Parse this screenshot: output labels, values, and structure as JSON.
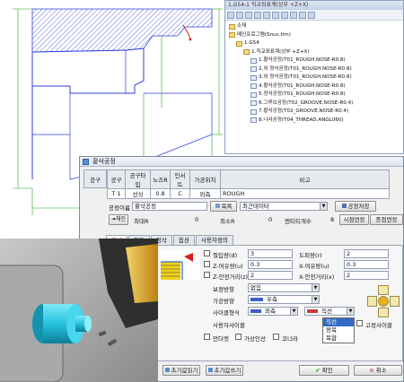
{
  "tree": {
    "title": "1.G54-1 직교좌표계(상부 +Z+X)",
    "items": [
      {
        "label": "소재",
        "level": 0,
        "kind": "folder"
      },
      {
        "label": "메인프로그램(Snuc.tlm)",
        "level": 0,
        "kind": "folder"
      },
      {
        "label": "1.G54",
        "level": 1,
        "kind": "folder"
      },
      {
        "label": "1.직교좌표계(상부 +Z+X)",
        "level": 2,
        "kind": "folder"
      },
      {
        "label": "1.황삭공정(T01_ROUGH.NOSE-R0.8)",
        "level": 3,
        "kind": "op"
      },
      {
        "label": "2.외 정삭공정(T01_ROUGH.NOSE-R0.8)",
        "level": 3,
        "kind": "op"
      },
      {
        "label": "3.외 정삭공정(T01_ROUGH.NOSE-R0.8)",
        "level": 3,
        "kind": "op"
      },
      {
        "label": "4.황삭공정(T01_ROUGH.NOSE-R0.8)",
        "level": 3,
        "kind": "op"
      },
      {
        "label": "5.정삭공정(T01_ROUGH.NOSE-R0.8)",
        "level": 3,
        "kind": "op"
      },
      {
        "label": "6.그루브공정(T02_GROOVE.NOSE-R0.4)",
        "level": 3,
        "kind": "op"
      },
      {
        "label": "7.황삭공정(T02_GROOVE.NOSE-R0.4)",
        "level": 3,
        "kind": "op"
      },
      {
        "label": "8.나사공정(T04_THREAD.ANGL060)",
        "level": 3,
        "kind": "op"
      }
    ]
  },
  "dialog": {
    "title": "황삭공정",
    "tool_label": "공구",
    "tool_headers": [
      "공구",
      "공구타입",
      "노즈R",
      "인서트",
      "가공위치",
      "비고"
    ],
    "tool_values": [
      "T 1",
      "선삭",
      "0.8",
      "C",
      "외측",
      "ROUGH"
    ],
    "process_name_label": "공정이름",
    "process_name_value": "황삭공정",
    "list_button": "목록",
    "recent_data": "최근데이터",
    "process_manage": "공정저장",
    "row2": {
      "label0": "채인",
      "label1": "최대R",
      "val1": "0",
      "label2": "최소R",
      "val2": "0",
      "label3": "엔티티개수",
      "val3": "8",
      "btn1": "시점연장",
      "btn2": "종점연장"
    },
    "tabs": [
      "황삭",
      "이동",
      "정삭",
      "옵션",
      "사용자정의"
    ],
    "fields": {
      "cut_depth_label": "절입량(d)",
      "cut_depth_value": "3",
      "retract_label": "도피량(r)",
      "retract_value": "2",
      "z_allow_label": "Z-여유량(u)",
      "z_allow_value": "0.3",
      "x_allow_label": "X-여유량(u)",
      "x_allow_value": "0.3",
      "z_safe_label": "Z-안전거리(z)",
      "z_safe_value": "2",
      "x_safe_label": "X-안전거리(x)",
      "x_safe_value": "2",
      "correction_label": "보정방향",
      "correction_value": "없음",
      "machining_dir_label": "가공방향",
      "machining_dir_value": "우측",
      "cycle_label": "사이클형식",
      "cycle_value": "외측",
      "line_value": "직선",
      "user_cycle_label": "사용자사이클",
      "fixed_cycle_label": "고정사이클",
      "check1": "언더컷",
      "check2": "가상인선",
      "check3": "코너라"
    },
    "dropdown_options": [
      "직선",
      "왕복",
      "복합"
    ],
    "footer": {
      "read_btn": "초기값읽기",
      "save_btn": "초기값쓰기",
      "ok": "확인",
      "cancel": "취소"
    }
  },
  "colors": {
    "hatch": "#3b4bd0",
    "dim": "#1ea81e",
    "part_line": "#2f3fd8",
    "cyan": "#24c3e0",
    "accent_red": "#c0282a",
    "tool_gold": "#e9b21c"
  }
}
